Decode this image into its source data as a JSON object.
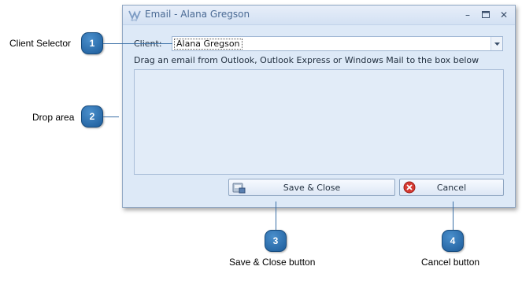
{
  "window": {
    "title": "Email - Alana Gregson",
    "minimize_symbol": "–",
    "close_symbol": "✕"
  },
  "form": {
    "client_label": "Client:",
    "client_value": "Alana Gregson",
    "instruction": "Drag an email from Outlook, Outlook Express or Windows Mail to the box below"
  },
  "buttons": {
    "save_close_label": "Save & Close",
    "cancel_label": "Cancel"
  },
  "callouts": [
    {
      "number": "1",
      "label": "Client Selector"
    },
    {
      "number": "2",
      "label": "Drop area"
    },
    {
      "number": "3",
      "label": "Save & Close button"
    },
    {
      "number": "4",
      "label": "Cancel button"
    }
  ],
  "colors": {
    "badge": "#2e74b5",
    "window_background": "#dde9f7",
    "title_text": "#4a6a94"
  }
}
